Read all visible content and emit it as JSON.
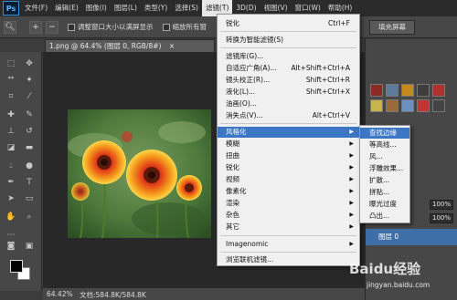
{
  "menubar": {
    "logo": "Ps",
    "items": [
      "文件(F)",
      "编辑(E)",
      "图像(I)",
      "图层(L)",
      "类型(Y)",
      "选择(S)",
      "滤镜(T)",
      "3D(D)",
      "视图(V)",
      "窗口(W)",
      "帮助(H)"
    ],
    "active_index": 6
  },
  "options": {
    "resize_label": "调整窗口大小以满屏显示",
    "zoom_all_label": "缩放所有窗",
    "fill_screen": "填充屏幕"
  },
  "document": {
    "tab_title": "1.png @ 64.4% (图层 0, RGB/8#)",
    "close_symbol": "×",
    "zoom": "64.42%",
    "doc_info": "文档:584.8K/584.8K"
  },
  "filter_menu": {
    "items": [
      {
        "label": "锐化",
        "shortcut": "Ctrl+F"
      },
      {
        "label": "转换为智能滤镜(S)"
      },
      {
        "label": "滤镜库(G)..."
      },
      {
        "label": "自适应广角(A)...",
        "shortcut": "Alt+Shift+Ctrl+A"
      },
      {
        "label": "镜头校正(R)...",
        "shortcut": "Shift+Ctrl+R"
      },
      {
        "label": "液化(L)...",
        "shortcut": "Shift+Ctrl+X"
      },
      {
        "label": "油画(O)..."
      },
      {
        "label": "消失点(V)...",
        "shortcut": "Alt+Ctrl+V"
      },
      {
        "label": "风格化"
      },
      {
        "label": "模糊"
      },
      {
        "label": "扭曲"
      },
      {
        "label": "锐化"
      },
      {
        "label": "视频"
      },
      {
        "label": "像素化"
      },
      {
        "label": "渲染"
      },
      {
        "label": "杂色"
      },
      {
        "label": "其它"
      },
      {
        "label": "Imagenomic"
      },
      {
        "label": "浏览联机滤镜..."
      }
    ],
    "highlighted_index": 8
  },
  "stylize_submenu": {
    "items": [
      "查找边缘",
      "等高线...",
      "风...",
      "浮雕效果...",
      "扩散...",
      "拼贴...",
      "曝光过度",
      "凸出..."
    ],
    "highlighted_index": 0
  },
  "panels": {
    "opacity": "100%",
    "fill": "100%",
    "layer_name": "图层 0"
  },
  "watermark": {
    "brand": "Baidu经验",
    "url": "jingyan.baidu.com"
  },
  "colors": {
    "highlight": "#3b77c5",
    "foreground": "#000000",
    "background": "#ffffff"
  }
}
